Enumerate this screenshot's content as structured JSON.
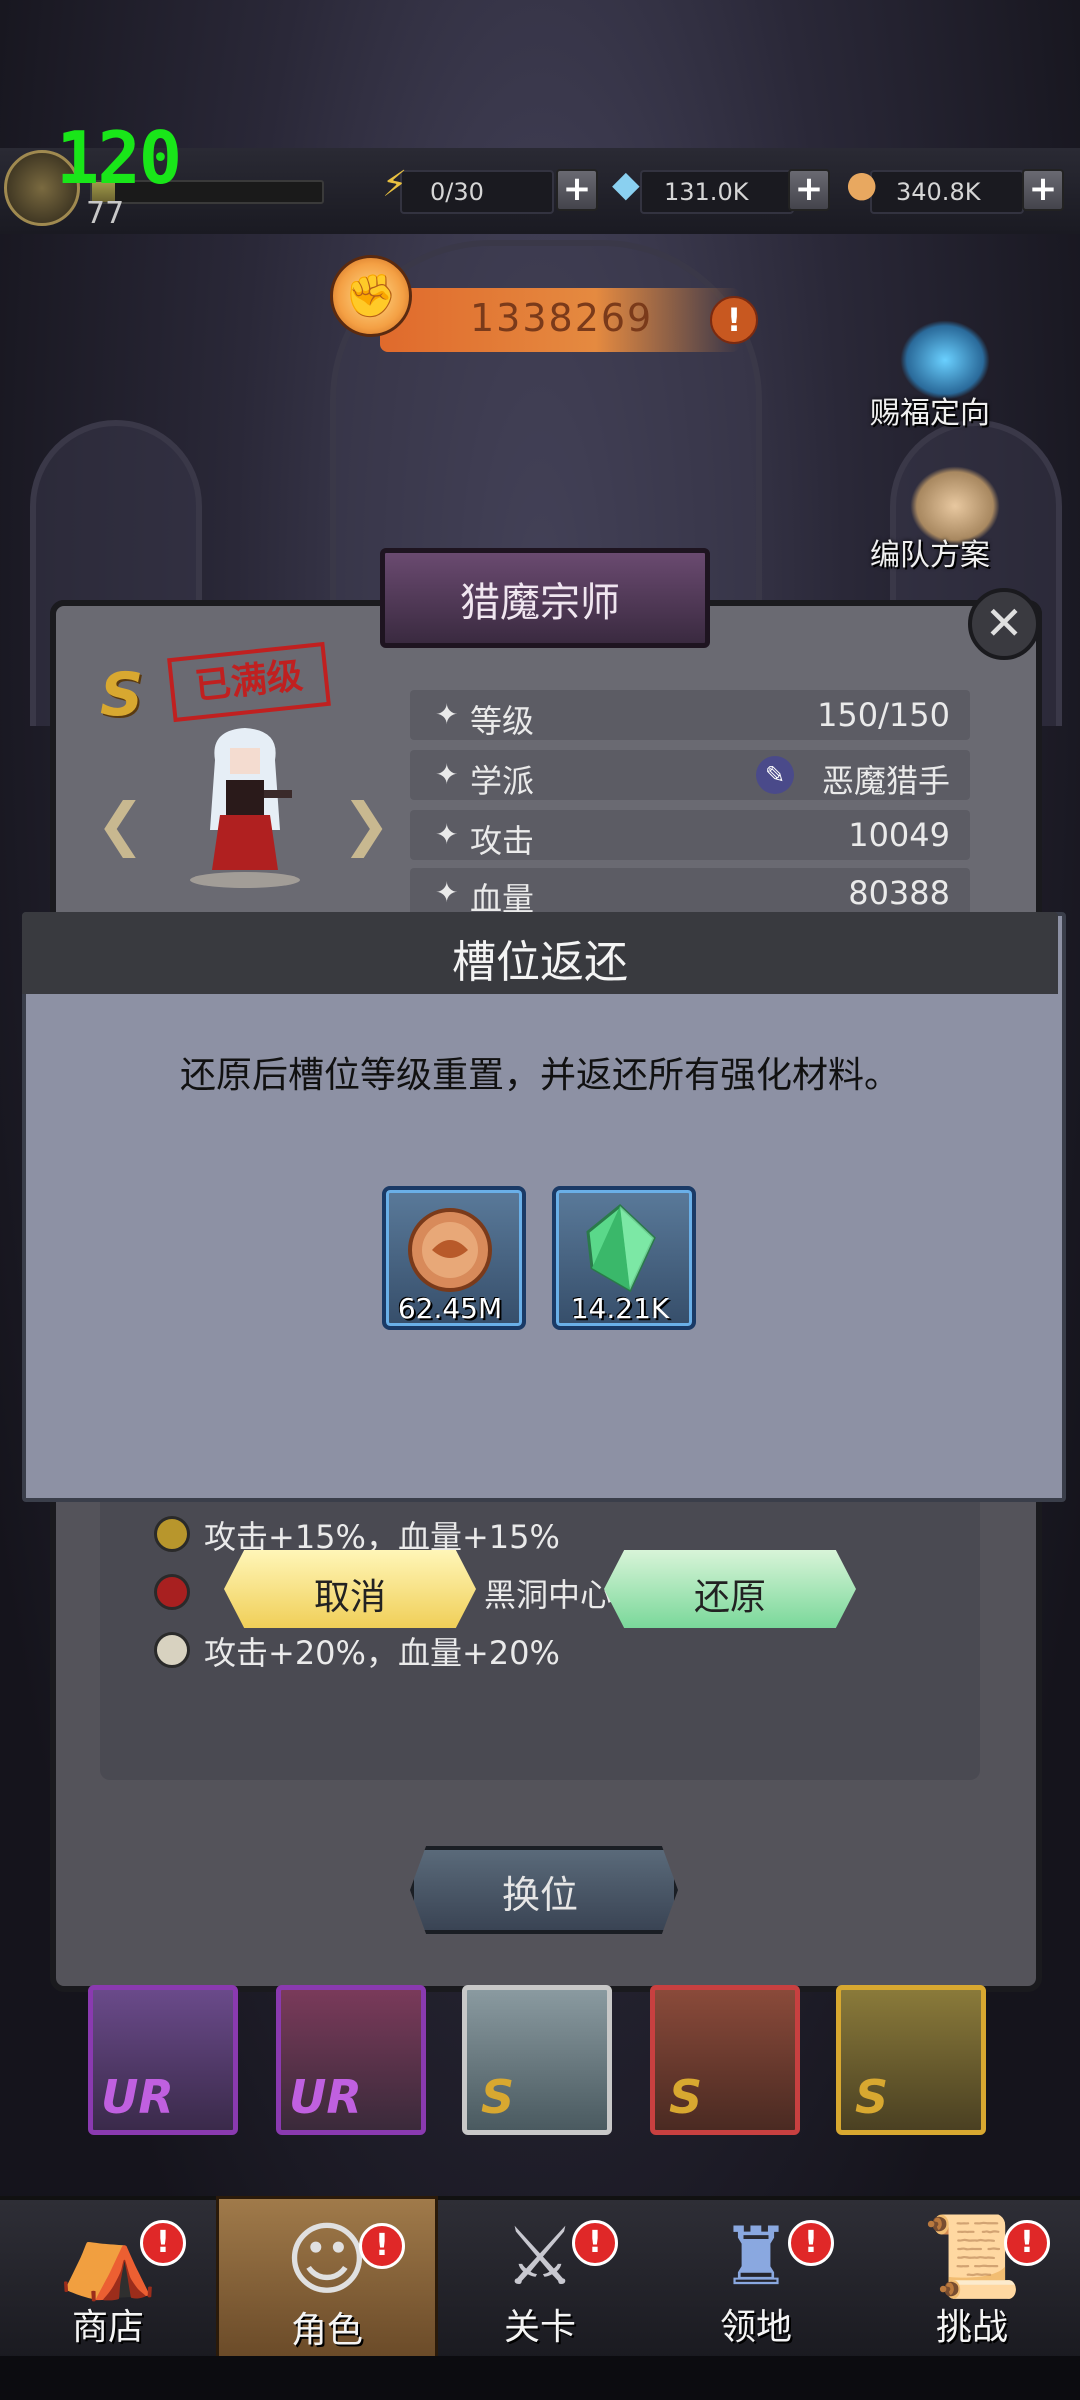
{
  "status": {
    "fps": "120"
  },
  "player": {
    "level": "77",
    "xp_progress": 0.1
  },
  "resources": [
    {
      "icon": "lightning-icon",
      "value": "0/30"
    },
    {
      "icon": "diamond-icon",
      "value": "131.0K"
    },
    {
      "icon": "coin-icon",
      "value": "340.8K"
    }
  ],
  "power": {
    "value": "1338269"
  },
  "side_buttons": {
    "blessing": "赐福定向",
    "formation": "编队方案"
  },
  "hero": {
    "name": "猎魔宗师",
    "rank": "S",
    "max_level_stamp": "已满级",
    "stats": [
      {
        "label": "等级",
        "value": "150/150"
      },
      {
        "label": "学派",
        "value": "恶魔猎手"
      },
      {
        "label": "攻击",
        "value": "10049"
      },
      {
        "label": "血量",
        "value": "80388"
      }
    ]
  },
  "slot_bonuses": [
    {
      "color": "#b8962c",
      "text": "攻击+15%，血量+15%"
    },
    {
      "color": "#a82020",
      "text": "黑洞中心"
    },
    {
      "color": "#d8d2c0",
      "text": "攻击+20%，血量+20%"
    }
  ],
  "swap_button": "换位",
  "hero_cards": [
    {
      "rank": "UR",
      "border": "#8a3ab0"
    },
    {
      "rank": "UR",
      "border": "#8a3ab0"
    },
    {
      "rank": "S",
      "border": "#c8c8c8"
    },
    {
      "rank": "S",
      "border": "#c84040"
    },
    {
      "rank": "S",
      "border": "#d8a830"
    }
  ],
  "modal": {
    "title": "槽位返还",
    "description": "还原后槽位等级重置，并返还所有强化材料。",
    "items": [
      {
        "icon": "coin-icon",
        "amount": "62.45M"
      },
      {
        "icon": "emerald-crystal-icon",
        "amount": "14.21K"
      }
    ],
    "cancel": "取消",
    "confirm": "还原"
  },
  "bottom_nav": [
    {
      "label": "商店",
      "icon": "shop-icon",
      "active": false
    },
    {
      "label": "角色",
      "icon": "character-icon",
      "active": true
    },
    {
      "label": "关卡",
      "icon": "crossed-swords-icon",
      "active": false
    },
    {
      "label": "领地",
      "icon": "castle-icon",
      "active": false
    },
    {
      "label": "挑战",
      "icon": "scroll-icon",
      "active": false
    }
  ]
}
